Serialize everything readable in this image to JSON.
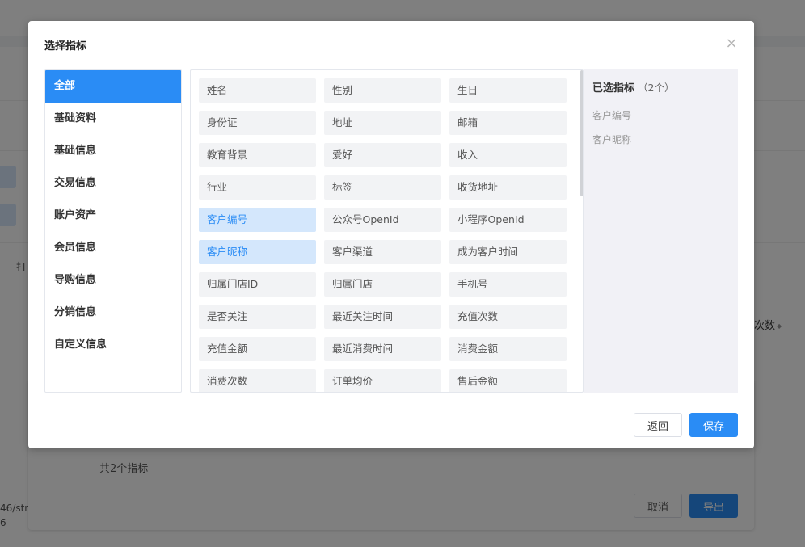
{
  "background": {
    "partial_button_text": "打",
    "column_title": "次数",
    "path_lines": "46/stri\n6",
    "total_text": "共2个指标",
    "cancel_label": "取消",
    "export_label": "导出"
  },
  "modal": {
    "title": "选择指标",
    "close_icon": "×",
    "categories": [
      {
        "label": "全部",
        "active": true
      },
      {
        "label": "基础资料"
      },
      {
        "label": "基础信息"
      },
      {
        "label": "交易信息"
      },
      {
        "label": "账户资产"
      },
      {
        "label": "会员信息"
      },
      {
        "label": "导购信息"
      },
      {
        "label": "分销信息"
      },
      {
        "label": "自定义信息"
      }
    ],
    "metrics": [
      {
        "label": "姓名"
      },
      {
        "label": "性别"
      },
      {
        "label": "生日"
      },
      {
        "label": "身份证"
      },
      {
        "label": "地址"
      },
      {
        "label": "邮箱"
      },
      {
        "label": "教育背景"
      },
      {
        "label": "爱好"
      },
      {
        "label": "收入"
      },
      {
        "label": "行业"
      },
      {
        "label": "标签"
      },
      {
        "label": "收货地址"
      },
      {
        "label": "客户编号",
        "selected": true
      },
      {
        "label": "公众号OpenId"
      },
      {
        "label": "小程序OpenId"
      },
      {
        "label": "客户昵称",
        "selected": true
      },
      {
        "label": "客户渠道"
      },
      {
        "label": "成为客户时间"
      },
      {
        "label": "归属门店ID"
      },
      {
        "label": "归属门店"
      },
      {
        "label": "手机号"
      },
      {
        "label": "是否关注"
      },
      {
        "label": "最近关注时间"
      },
      {
        "label": "充值次数"
      },
      {
        "label": "充值金额"
      },
      {
        "label": "最近消费时间"
      },
      {
        "label": "消费金额"
      },
      {
        "label": "消费次数"
      },
      {
        "label": "订单均价"
      },
      {
        "label": "售后金额"
      }
    ],
    "selected_title": "已选指标",
    "selected_count": "（2个）",
    "selected_items": [
      "客户编号",
      "客户昵称"
    ],
    "back_label": "返回",
    "save_label": "保存",
    "colors": {
      "primary": "#2a8cf5",
      "selected_bg": "#d4e7fc",
      "metric_bg": "#f2f3f5",
      "selected_panel_bg": "#f1f1f6"
    }
  }
}
